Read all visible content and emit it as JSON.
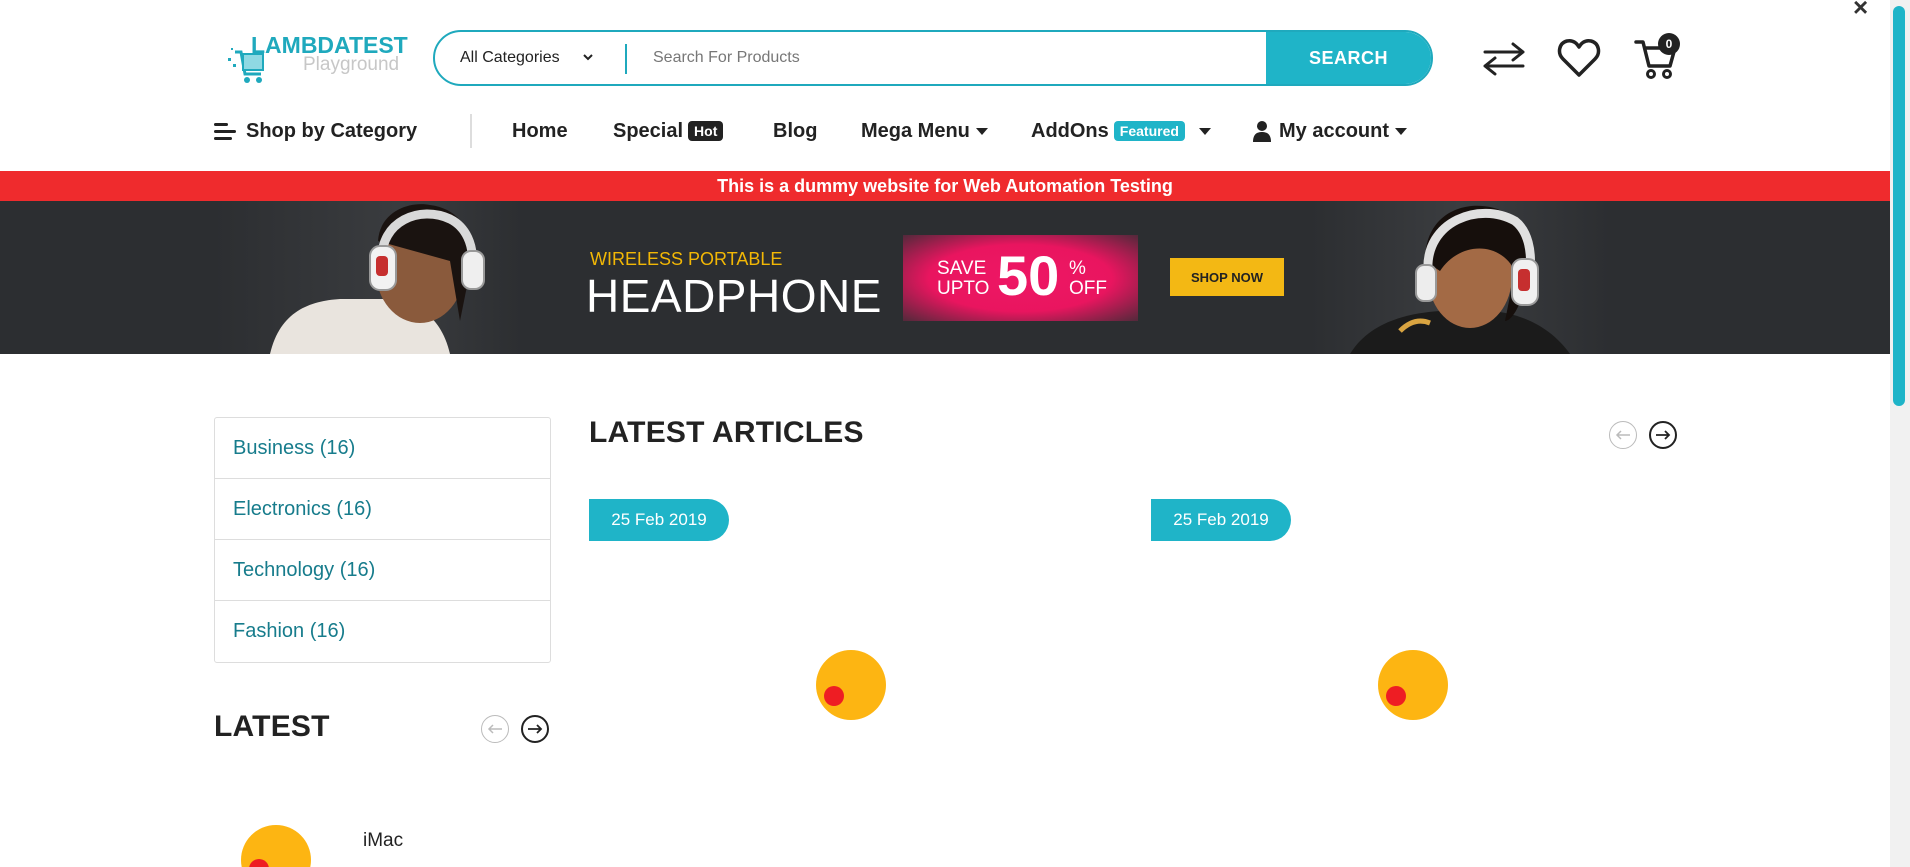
{
  "brand": {
    "name": "LAMBDATEST",
    "sub": "Playground"
  },
  "search": {
    "category": "All Categories",
    "placeholder": "Search For Products",
    "button": "SEARCH"
  },
  "header_icons": {
    "compare": "compare-arrows-icon",
    "wishlist": "heart-icon",
    "cart": "cart-icon",
    "cart_count": "0"
  },
  "nav": {
    "shop_by_category": "Shop by Category",
    "home": "Home",
    "special": "Special",
    "special_badge": "Hot",
    "blog": "Blog",
    "mega_menu": "Mega Menu",
    "addons": "AddOns",
    "addons_badge": "Featured",
    "my_account": "My account"
  },
  "notice": "This is a dummy website for Web Automation Testing",
  "banner": {
    "kicker": "WIRELESS PORTABLE",
    "title": "HEADPHONE",
    "save_line1": "SAVE",
    "save_line2": "UPTO",
    "save_pct": "50",
    "pct_sign": "%",
    "off": "OFF",
    "cta": "SHOP NOW"
  },
  "categories": [
    "Business (16)",
    "Electronics (16)",
    "Technology (16)",
    "Fashion (16)"
  ],
  "latest_articles": {
    "title": "LATEST ARTICLES",
    "dates": [
      "25 Feb 2019",
      "25 Feb 2019"
    ]
  },
  "latest": {
    "title": "LATEST",
    "first_item": "iMac"
  },
  "colors": {
    "accent": "#1fb4c8",
    "notice_red": "#ef2b2d",
    "banner_bg": "#2c2e31",
    "cta_yellow": "#f3b814",
    "sale_pink": "#ee1765"
  }
}
